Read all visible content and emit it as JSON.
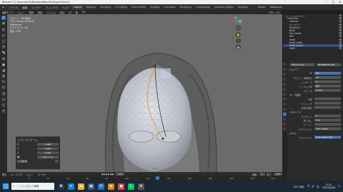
{
  "window": {
    "title": "Blender* [C:\\Users\\kenji\\Desktop\\Blender\\Suguri.blend]"
  },
  "menubar": {
    "menus": [
      "ファイル",
      "編集",
      "レンダー",
      "ウィンドウ",
      "ヘルプ"
    ],
    "tabs": [
      "Layout",
      "Modeling",
      "Sculpting",
      "UV Editing",
      "Texture Paint",
      "Shading",
      "Animation",
      "Rendering",
      "Compositing",
      "Geometry Nodes",
      "Scripting"
    ],
    "active_tab": "Layout",
    "scene": "Scene",
    "layer": "ViewLayer"
  },
  "header3d": {
    "items": [
      "編集モード",
      "ビュー",
      "選択",
      "追加",
      "メッシュ",
      "頂点",
      "辺",
      "面",
      "UV",
      "グローバル"
    ]
  },
  "toolbar": {
    "icons": [
      "cursor-icon",
      "move-icon",
      "rotate-icon",
      "scale-icon",
      "transform-icon",
      "annotate-icon",
      "measure-icon",
      "extrude-icon",
      "inset-icon",
      "bevel-icon",
      "loopcut-icon",
      "knife-icon",
      "polybuild-icon",
      "spin-icon",
      "smooth-icon",
      "shear-icon",
      "rip-icon"
    ],
    "active_index": 0
  },
  "viewport": {
    "info": [
      "フロント・平行投影",
      "(151) Head | Vertices",
      "Defensive",
      "",
      "オブジェクト 1/3",
      "頂点 1/78"
    ],
    "gizmo_tools": [
      "+",
      "✋",
      "🎥",
      "▦"
    ]
  },
  "operator_panel": {
    "title": "トランスフォーム",
    "rows": [
      {
        "label": "X",
        "value": "0.000"
      },
      {
        "label": "Y",
        "value": "0.000"
      },
      {
        "label": "Z",
        "value": "0.000"
      },
      {
        "label": "軸",
        "value": "グローバル"
      },
      {
        "label": "比例編集",
        "value": ""
      }
    ]
  },
  "timeline": {
    "header": [
      "再生",
      "キーイング",
      "ビュー",
      "マーカー"
    ],
    "start_label": "開始",
    "start": "1",
    "end_label": "終了",
    "end": "250",
    "current": "151",
    "ruler": [
      "0",
      "20",
      "40",
      "60",
      "80",
      "100",
      "120",
      "140",
      "160",
      "180",
      "200",
      "220",
      "240"
    ]
  },
  "outliner": {
    "search_placeholder": "",
    "items": [
      {
        "label": "シーンコレクション",
        "sel": false
      },
      {
        "label": "Collection",
        "sel": false
      },
      {
        "label": "Camera",
        "sel": false
      },
      {
        "label": "エンプティ",
        "sel": false
      },
      {
        "label": "Armature",
        "sel": false
      },
      {
        "label": "Body",
        "sel": false
      },
      {
        "label": "Eye_shape",
        "sel": false
      },
      {
        "label": "Hair",
        "sel": false
      },
      {
        "label": "Head",
        "sel": false
      },
      {
        "label": "Head_mesh",
        "sel": false
      },
      {
        "label": "Head_shape",
        "sel": true
      },
      {
        "label": "Light",
        "sel": false
      }
    ]
  },
  "properties": {
    "object_name": "Head_mesh",
    "data_name": "NURBSPath.001",
    "rows": [
      {
        "type": "sec",
        "label": "シェイプ"
      },
      {
        "label": "2D",
        "value": "3D",
        "blue": true
      },
      {
        "label": "プレビュー解像度U",
        "value": "12"
      },
      {
        "label": "レンダー U",
        "value": "0"
      },
      {
        "label": "ツイスト方法",
        "value": "最小"
      },
      {
        "label": "スムーズ",
        "value": "0.000"
      },
      {
        "type": "sec",
        "label": "カーブ変形"
      },
      {
        "label": "半径",
        "value": ""
      },
      {
        "label": "ストレッチ",
        "value": ""
      },
      {
        "label": "境界を固定",
        "value": ""
      },
      {
        "type": "sec",
        "label": "ジオメトリ"
      },
      {
        "label": "オフセット",
        "value": "0"
      },
      {
        "label": "押し出し",
        "value": "0 m"
      },
      {
        "label": "テーパー",
        "value": ""
      },
      {
        "label": "オブジェクト",
        "value": "Pipe_shape"
      },
      {
        "type": "sec",
        "label": "ベベル"
      },
      {
        "label": "オブジェクト",
        "value": "Pipe_shape.001",
        "blue": true
      }
    ]
  },
  "taskbar": {
    "search_placeholder": "ここに入力して検索",
    "apps": [
      {
        "icon": "task-view-icon",
        "glyph": "⧉",
        "color": "#2a3645"
      },
      {
        "icon": "edge-icon",
        "glyph": "e",
        "color": "#1f7fc7"
      },
      {
        "icon": "folder-icon",
        "glyph": "▬",
        "color": "#e7b33b"
      },
      {
        "icon": "store-icon",
        "glyph": "▣",
        "color": "#3a5a80"
      },
      {
        "icon": "mail-icon",
        "glyph": "✉",
        "color": "#2a6fbd"
      },
      {
        "icon": "blender-icon",
        "glyph": "◉",
        "color": "#e87d0d"
      },
      {
        "icon": "chrome-icon",
        "glyph": "●",
        "color": "#d94a3a"
      },
      {
        "icon": "line-icon",
        "glyph": "L",
        "color": "#06c755"
      },
      {
        "icon": "settings-icon",
        "glyph": "⚙",
        "color": "#555"
      }
    ],
    "tray": {
      "temp": "30°C 晴れ",
      "ime": "あ",
      "time": "17:21",
      "date": "2022/05/08"
    }
  },
  "colors": {
    "accent": "#4772b3",
    "viewport_bg": "#6b6b6b",
    "taskbar": "#1b2836"
  }
}
